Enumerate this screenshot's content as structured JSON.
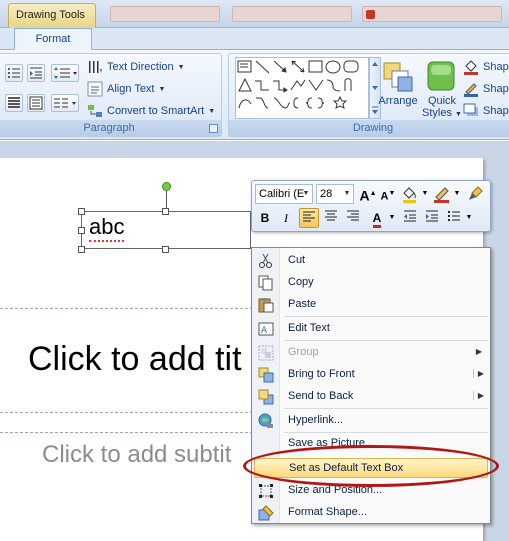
{
  "titlebar": {
    "tools_tab": "Drawing Tools"
  },
  "ribbon": {
    "format_tab": "Format",
    "paragraph_group": {
      "label": "Paragraph",
      "text_direction": "Text Direction",
      "align_text": "Align Text",
      "convert_smartart": "Convert to SmartArt"
    },
    "drawing_group": {
      "label": "Drawing",
      "arrange": "Arrange",
      "quick_styles_line1": "Quick",
      "quick_styles_line2": "Styles",
      "shape_fill": "Shap",
      "shape_outline": "Shap",
      "shape_effects": "Shap"
    }
  },
  "slide": {
    "textbox_text": "abc",
    "title_placeholder": "Click to add tit",
    "subtitle_placeholder": "Click to add subtit"
  },
  "mini_toolbar": {
    "font": "Calibri (E",
    "size": "28",
    "grow_font": "A",
    "shrink_font": "A",
    "bold": "B",
    "italic": "I",
    "font_color": "A"
  },
  "context_menu": {
    "items": [
      {
        "label": "Cut"
      },
      {
        "label": "Copy"
      },
      {
        "label": "Paste"
      },
      {
        "label": "Edit Text"
      },
      {
        "label": "Group"
      },
      {
        "label": "Bring to Front"
      },
      {
        "label": "Send to Back"
      },
      {
        "label": "Hyperlink..."
      },
      {
        "label": "Save as Picture..."
      },
      {
        "label": "Set as Default Text Box"
      },
      {
        "label": "Size and Position..."
      },
      {
        "label": "Format Shape..."
      }
    ]
  },
  "colors": {
    "ribbon_text": "#15428b",
    "highlight": "#fbd97a",
    "annotation_ellipse": "#b01818"
  }
}
